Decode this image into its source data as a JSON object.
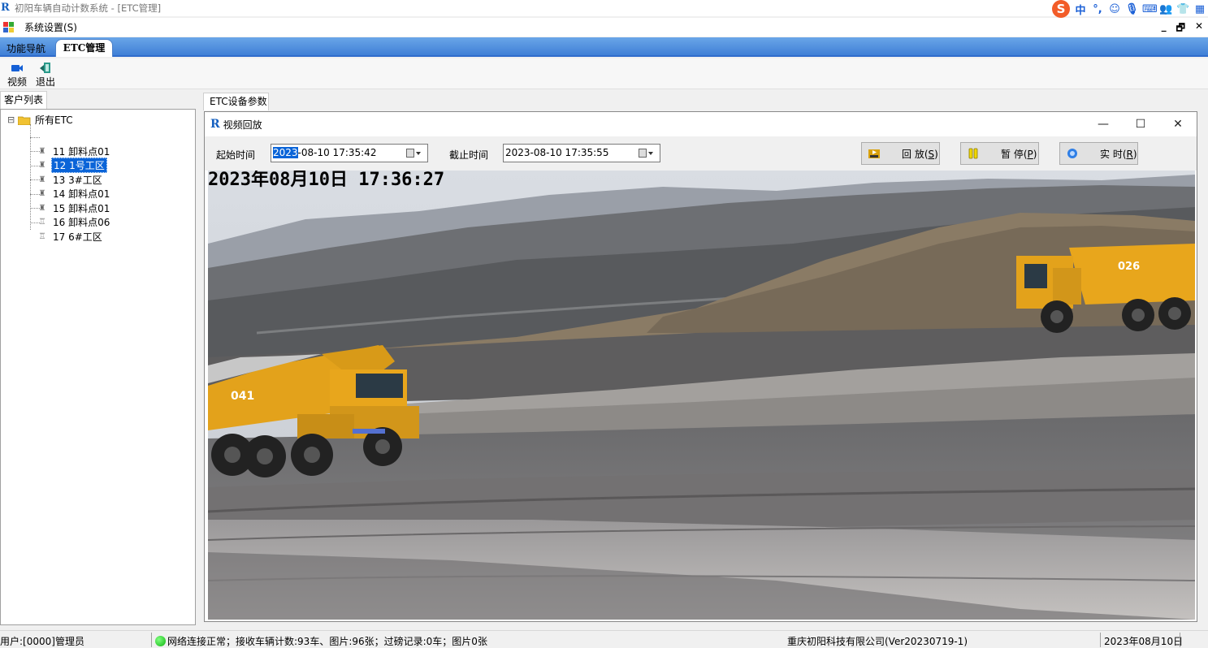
{
  "window": {
    "title": "初阳车辆自动计数系统 - [ETC管理]",
    "logo_text": "R"
  },
  "ime_bar": {
    "logo": "S",
    "items": [
      "中",
      "°,",
      "☺",
      "🎙",
      "⌨",
      "👥",
      "👕",
      "▦"
    ]
  },
  "menubar": {
    "menu_label": "系统设置(S)",
    "win_controls": [
      "_",
      "🗗",
      "✕"
    ]
  },
  "tabs": {
    "nav_label": "功能导航",
    "etc_label": "ETC管理"
  },
  "toolbar": {
    "video_label": "视频",
    "exit_label": "退出"
  },
  "left_panel": {
    "tab_label": "客户列表",
    "root": {
      "label": "所有ETC",
      "expander": "⊟"
    },
    "items": [
      {
        "label": "11 卸料点01",
        "selected": false
      },
      {
        "label": "12 1号工区",
        "selected": true
      },
      {
        "label": "13 3#工区",
        "selected": false
      },
      {
        "label": "14 卸料点01",
        "selected": false
      },
      {
        "label": "15 卸料点01",
        "selected": false
      },
      {
        "label": "16 卸料点06",
        "selected": false
      },
      {
        "label": "17 6#工区",
        "selected": false
      }
    ]
  },
  "right_panel": {
    "tab_label": "ETC设备参数"
  },
  "dialog": {
    "logo_text": "R",
    "title": "视频回放",
    "controls": [
      "—",
      "☐",
      "✕"
    ],
    "start_label": "起始时间",
    "start_value_highlight": "2023",
    "start_value_rest": "-08-10 17:35:42",
    "end_label": "截止时间",
    "end_value": "2023-08-10 17:35:55",
    "playback": {
      "label": "回 放(",
      "key": "S",
      "suffix": ")"
    },
    "pause": {
      "label": "暂 停(",
      "key": "P",
      "suffix": ")"
    },
    "live": {
      "label": "实 时(",
      "key": "R",
      "suffix": ")"
    },
    "osd_timestamp": "2023年08月10日  17:36:27",
    "truck_left_number": "041",
    "truck_right_number": "026"
  },
  "statusbar": {
    "user": "用户:[0000]管理员",
    "network": "网络连接正常；接收车辆计数:93车、图片:96张；过磅记录:0车；图片0张",
    "company": "重庆初阳科技有限公司(Ver20230719-1)",
    "date": "2023年08月10日"
  },
  "colors": {
    "accent_blue": "#0a64d8",
    "tab_strip": "#4a8be0",
    "truck_yellow": "#e8a61c",
    "status_green": "#11b511"
  }
}
